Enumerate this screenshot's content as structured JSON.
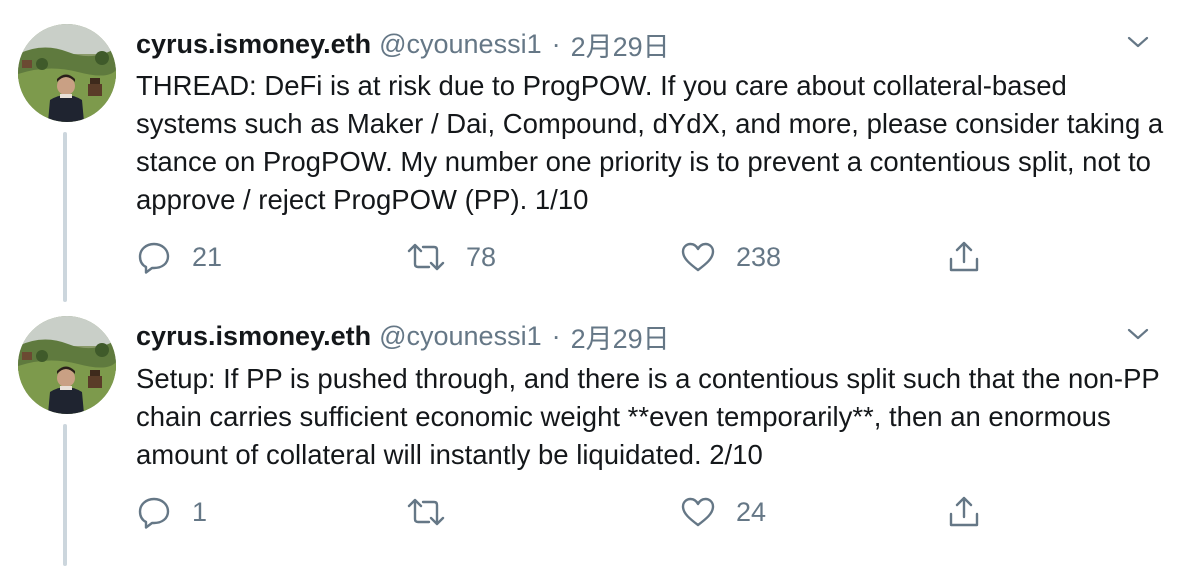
{
  "tweets": [
    {
      "display_name": "cyrus.ismoney.eth",
      "handle": "@cyounessi1",
      "separator": "·",
      "date": "2月29日",
      "text": "THREAD: DeFi is at risk due to ProgPOW. If you care about collateral-based systems such as Maker / Dai, Compound, dYdX, and more, please consider taking a stance on ProgPOW. My number one priority is to prevent a contentious split, not to approve / reject ProgPOW (PP). 1/10",
      "replies": "21",
      "retweets": "78",
      "likes": "238"
    },
    {
      "display_name": "cyrus.ismoney.eth",
      "handle": "@cyounessi1",
      "separator": "·",
      "date": "2月29日",
      "text": "Setup: If PP is pushed through, and there is a contentious split such that the non-PP chain carries sufficient economic weight **even temporarily**, then an enormous amount of collateral will instantly be liquidated. 2/10",
      "replies": "1",
      "retweets": "",
      "likes": "24"
    }
  ],
  "icons": {
    "reply": "reply-icon",
    "retweet": "retweet-icon",
    "like": "heart-icon",
    "share": "share-icon",
    "caret": "chevron-down-icon"
  },
  "colors": {
    "text": "#14171a",
    "secondary": "#657786",
    "thread_line": "#ccd6dd"
  }
}
